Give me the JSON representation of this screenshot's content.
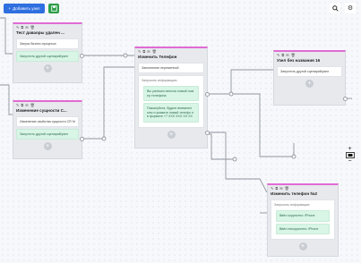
{
  "toolbar": {
    "add_node_label": "Добавить узел",
    "plus_icon": "+",
    "save_icon": "save-icon",
    "search_icon": "🔍",
    "settings_icon": "⚙"
  },
  "colors": {
    "primary_button": "#2f6fe0",
    "save_button": "#2e9e4a",
    "node_accent": "#e06bd3",
    "green_block": "#d8f5e6"
  },
  "nodes": {
    "n1": {
      "title": "Тест даваоры удален ...",
      "icons": [
        "✎",
        "⧉",
        "✉",
        "🗑"
      ],
      "block1": "Запуск бизнес-процесса",
      "block2": "Запустить другой сценарий/узел",
      "plus": "+"
    },
    "n2": {
      "title": "Изменение сущности С...",
      "icons": [
        "✎",
        "⧉",
        "✉",
        "🗑"
      ],
      "block1": "Изменение свойства сущности CR М",
      "block2": "Запустить другой сценарий/узел",
      "plus": "+"
    },
    "n3": {
      "title": "Изменить Телефон",
      "icons": [
        "✎",
        "⧉",
        "✉",
        "🗑"
      ],
      "block1": "Заполнение переменной",
      "subhead": "Запросить информацию",
      "bubble1": "Вы успешно внесли новый ном ер телефона",
      "bubble2": "Пожалуйста, будьте внимател ьны и укажите новый телефо н в формате +7 XXX XXX XX XX",
      "plus": "+"
    },
    "n4": {
      "title": "Узел без названия 16",
      "icons": [
        "✎",
        "⧉",
        "✉",
        "🗑"
      ],
      "block1": "Запустить другой сценарий/узел",
      "plus": "+"
    },
    "n5": {
      "title": "Изменить телефон №2",
      "icons": [
        "✎",
        "⧉",
        "✉",
        "🗑"
      ],
      "subhead": "Запросить информацию",
      "bubble1": "Ввёл корректно: iPhone",
      "bubble2": "Ввёл некорректно: iPhone",
      "plus": "+"
    }
  },
  "zoom": {
    "plus": "+",
    "minus": "−",
    "fit_icon": "fit-view-icon"
  }
}
